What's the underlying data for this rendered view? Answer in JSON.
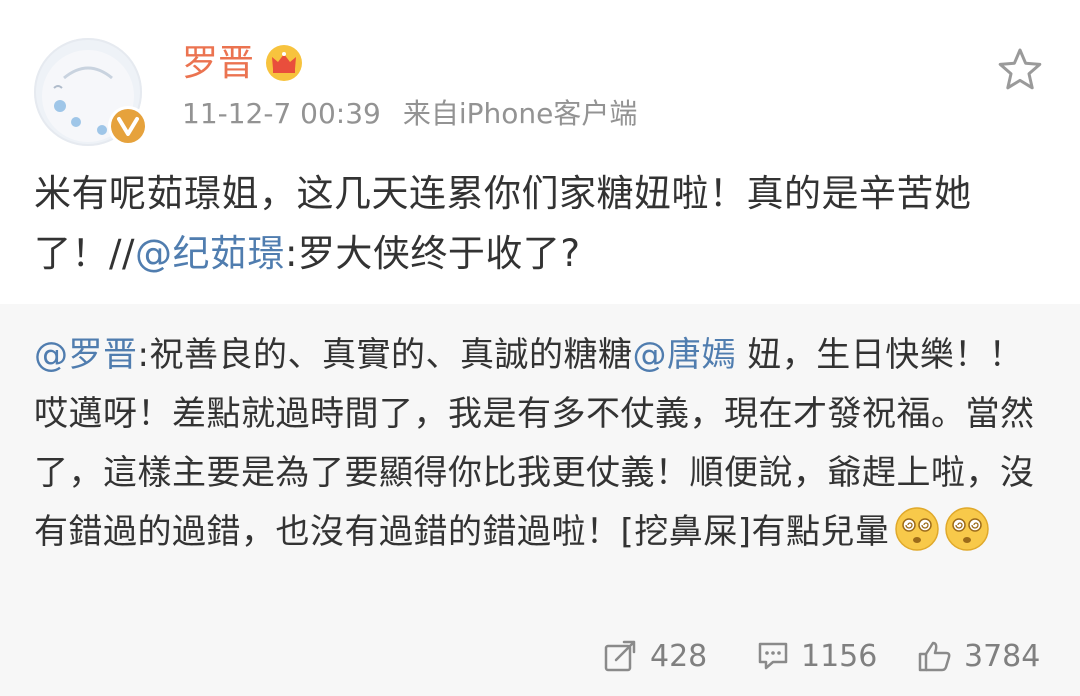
{
  "user": {
    "name": "罗晋",
    "timestamp": "11-12-7 00:39",
    "source": "来自iPhone客户端"
  },
  "post": {
    "text_part1": "米有呢茹璟姐，这几天连累你们家糖妞啦！真的是辛苦她了！//",
    "mention": "@纪茹璟",
    "text_part2": ":罗大侠终于收了?"
  },
  "repost": {
    "mention_author": "@罗晋",
    "text_part1": ":祝善良的、真實的、真誠的糖糖",
    "mention_tag": "@唐嫣",
    "text_part2": " 妞，生日快樂！！哎邁呀！差點就過時間了，我是有多不仗義，現在才發祝福。當然了，這樣主要是為了要顯得你比我更仗義！順便說，爺趕上啦，沒有錯過的過錯，也沒有過錯的錯過啦！[挖鼻屎]有點兒暈",
    "emoji_names": [
      "dizzy-face-emoji",
      "dizzy-face-emoji"
    ]
  },
  "stats": {
    "reposts": "428",
    "comments": "1156",
    "likes": "3784"
  },
  "icons": {
    "badge": "verified-v-icon",
    "crown": "crown-icon",
    "favorite": "star-icon",
    "repost": "repost-icon",
    "comment": "comment-icon",
    "like": "thumbs-up-icon"
  },
  "colors": {
    "username": "#eb7350",
    "link": "#507daf",
    "meta": "#939393",
    "repost_bg": "#f7f7f7",
    "badge": "#e6a23c"
  }
}
